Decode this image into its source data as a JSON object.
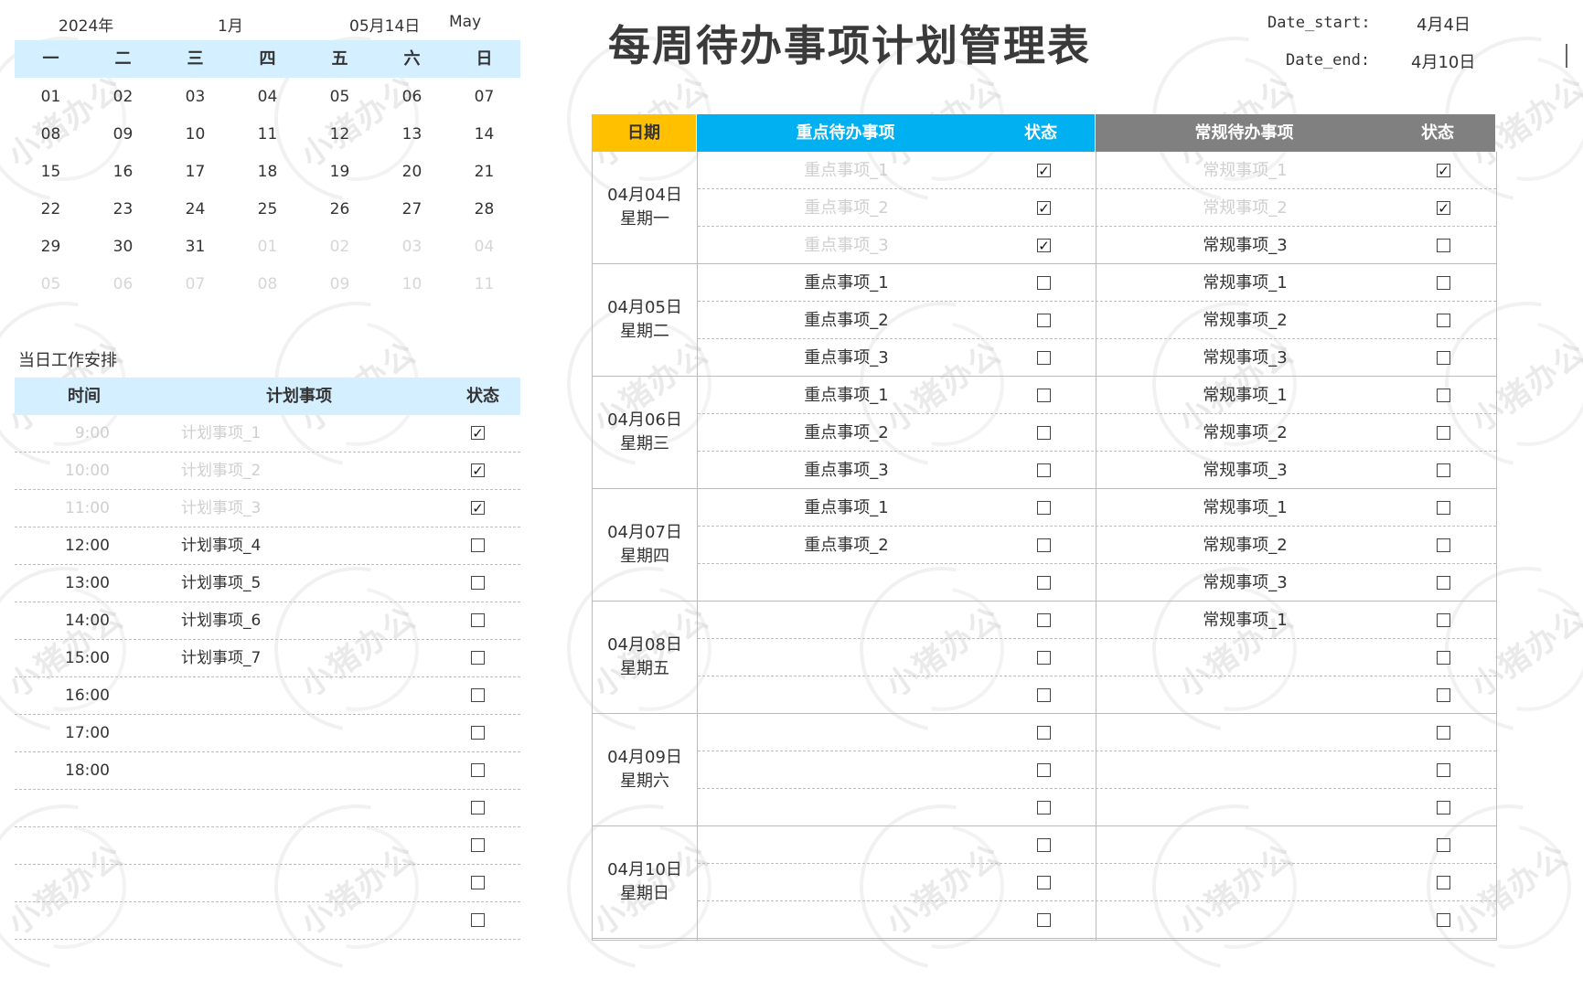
{
  "calendar": {
    "year": "2024年",
    "month": "1月",
    "today": "05月14日",
    "month_en": "May",
    "weekdays": [
      "一",
      "二",
      "三",
      "四",
      "五",
      "六",
      "日"
    ],
    "weeks": [
      [
        {
          "d": "01",
          "dim": false
        },
        {
          "d": "02",
          "dim": false
        },
        {
          "d": "03",
          "dim": false
        },
        {
          "d": "04",
          "dim": false
        },
        {
          "d": "05",
          "dim": false
        },
        {
          "d": "06",
          "dim": false
        },
        {
          "d": "07",
          "dim": false
        }
      ],
      [
        {
          "d": "08",
          "dim": false
        },
        {
          "d": "09",
          "dim": false
        },
        {
          "d": "10",
          "dim": false
        },
        {
          "d": "11",
          "dim": false
        },
        {
          "d": "12",
          "dim": false
        },
        {
          "d": "13",
          "dim": false
        },
        {
          "d": "14",
          "dim": false
        }
      ],
      [
        {
          "d": "15",
          "dim": false
        },
        {
          "d": "16",
          "dim": false
        },
        {
          "d": "17",
          "dim": false
        },
        {
          "d": "18",
          "dim": false
        },
        {
          "d": "19",
          "dim": false
        },
        {
          "d": "20",
          "dim": false
        },
        {
          "d": "21",
          "dim": false
        }
      ],
      [
        {
          "d": "22",
          "dim": false
        },
        {
          "d": "23",
          "dim": false
        },
        {
          "d": "24",
          "dim": false
        },
        {
          "d": "25",
          "dim": false
        },
        {
          "d": "26",
          "dim": false
        },
        {
          "d": "27",
          "dim": false
        },
        {
          "d": "28",
          "dim": false
        }
      ],
      [
        {
          "d": "29",
          "dim": false
        },
        {
          "d": "30",
          "dim": false
        },
        {
          "d": "31",
          "dim": false
        },
        {
          "d": "01",
          "dim": true
        },
        {
          "d": "02",
          "dim": true
        },
        {
          "d": "03",
          "dim": true
        },
        {
          "d": "04",
          "dim": true
        }
      ],
      [
        {
          "d": "05",
          "dim": true
        },
        {
          "d": "06",
          "dim": true
        },
        {
          "d": "07",
          "dim": true
        },
        {
          "d": "08",
          "dim": true
        },
        {
          "d": "09",
          "dim": true
        },
        {
          "d": "10",
          "dim": true
        },
        {
          "d": "11",
          "dim": true
        }
      ]
    ]
  },
  "schedule": {
    "title": "当日工作安排",
    "col_time": "时间",
    "col_item": "计划事项",
    "col_status": "状态",
    "rows": [
      {
        "time": "9:00",
        "item": "计划事项_1",
        "done": true
      },
      {
        "time": "10:00",
        "item": "计划事项_2",
        "done": true
      },
      {
        "time": "11:00",
        "item": "计划事项_3",
        "done": true
      },
      {
        "time": "12:00",
        "item": "计划事项_4",
        "done": false
      },
      {
        "time": "13:00",
        "item": "计划事项_5",
        "done": false
      },
      {
        "time": "14:00",
        "item": "计划事项_6",
        "done": false
      },
      {
        "time": "15:00",
        "item": "计划事项_7",
        "done": false
      },
      {
        "time": "16:00",
        "item": "",
        "done": false
      },
      {
        "time": "17:00",
        "item": "",
        "done": false
      },
      {
        "time": "18:00",
        "item": "",
        "done": false
      },
      {
        "time": "",
        "item": "",
        "done": false
      },
      {
        "time": "",
        "item": "",
        "done": false
      },
      {
        "time": "",
        "item": "",
        "done": false
      },
      {
        "time": "",
        "item": "",
        "done": false
      }
    ]
  },
  "header": {
    "title": "每周待办事项计划管理表",
    "date_start_label": "Date_start:",
    "date_start": "4月4日",
    "date_end_label": "Date_end:",
    "date_end": "4月10日"
  },
  "weekly": {
    "col_date": "日期",
    "col_key": "重点待办事项",
    "col_key_status": "状态",
    "col_reg": "常规待办事项",
    "col_reg_status": "状态",
    "days": [
      {
        "date": "04月04日",
        "weekday": "星期一",
        "rows": [
          {
            "key": "重点事项_1",
            "key_done": true,
            "reg": "常规事项_1",
            "reg_done": true
          },
          {
            "key": "重点事项_2",
            "key_done": true,
            "reg": "常规事项_2",
            "reg_done": true
          },
          {
            "key": "重点事项_3",
            "key_done": true,
            "reg": "常规事项_3",
            "reg_done": false
          }
        ]
      },
      {
        "date": "04月05日",
        "weekday": "星期二",
        "rows": [
          {
            "key": "重点事项_1",
            "key_done": false,
            "reg": "常规事项_1",
            "reg_done": false
          },
          {
            "key": "重点事项_2",
            "key_done": false,
            "reg": "常规事项_2",
            "reg_done": false
          },
          {
            "key": "重点事项_3",
            "key_done": false,
            "reg": "常规事项_3",
            "reg_done": false
          }
        ]
      },
      {
        "date": "04月06日",
        "weekday": "星期三",
        "rows": [
          {
            "key": "重点事项_1",
            "key_done": false,
            "reg": "常规事项_1",
            "reg_done": false
          },
          {
            "key": "重点事项_2",
            "key_done": false,
            "reg": "常规事项_2",
            "reg_done": false
          },
          {
            "key": "重点事项_3",
            "key_done": false,
            "reg": "常规事项_3",
            "reg_done": false
          }
        ]
      },
      {
        "date": "04月07日",
        "weekday": "星期四",
        "rows": [
          {
            "key": "重点事项_1",
            "key_done": false,
            "reg": "常规事项_1",
            "reg_done": false
          },
          {
            "key": "重点事项_2",
            "key_done": false,
            "reg": "常规事项_2",
            "reg_done": false
          },
          {
            "key": "",
            "key_done": false,
            "reg": "常规事项_3",
            "reg_done": false
          }
        ]
      },
      {
        "date": "04月08日",
        "weekday": "星期五",
        "rows": [
          {
            "key": "",
            "key_done": false,
            "reg": "常规事项_1",
            "reg_done": false
          },
          {
            "key": "",
            "key_done": false,
            "reg": "",
            "reg_done": false
          },
          {
            "key": "",
            "key_done": false,
            "reg": "",
            "reg_done": false
          }
        ]
      },
      {
        "date": "04月09日",
        "weekday": "星期六",
        "rows": [
          {
            "key": "",
            "key_done": false,
            "reg": "",
            "reg_done": false
          },
          {
            "key": "",
            "key_done": false,
            "reg": "",
            "reg_done": false
          },
          {
            "key": "",
            "key_done": false,
            "reg": "",
            "reg_done": false
          }
        ]
      },
      {
        "date": "04月10日",
        "weekday": "星期日",
        "rows": [
          {
            "key": "",
            "key_done": false,
            "reg": "",
            "reg_done": false
          },
          {
            "key": "",
            "key_done": false,
            "reg": "",
            "reg_done": false
          },
          {
            "key": "",
            "key_done": false,
            "reg": "",
            "reg_done": false
          }
        ]
      }
    ]
  },
  "watermark": {
    "text": "小猪办公"
  },
  "icons": {
    "checked": "checkbox-checked-icon",
    "unchecked": "checkbox-empty-icon"
  },
  "colors": {
    "date_header": "#ffc000",
    "key_header": "#00b0f0",
    "reg_header": "#808080",
    "light_header": "#d4efff"
  }
}
